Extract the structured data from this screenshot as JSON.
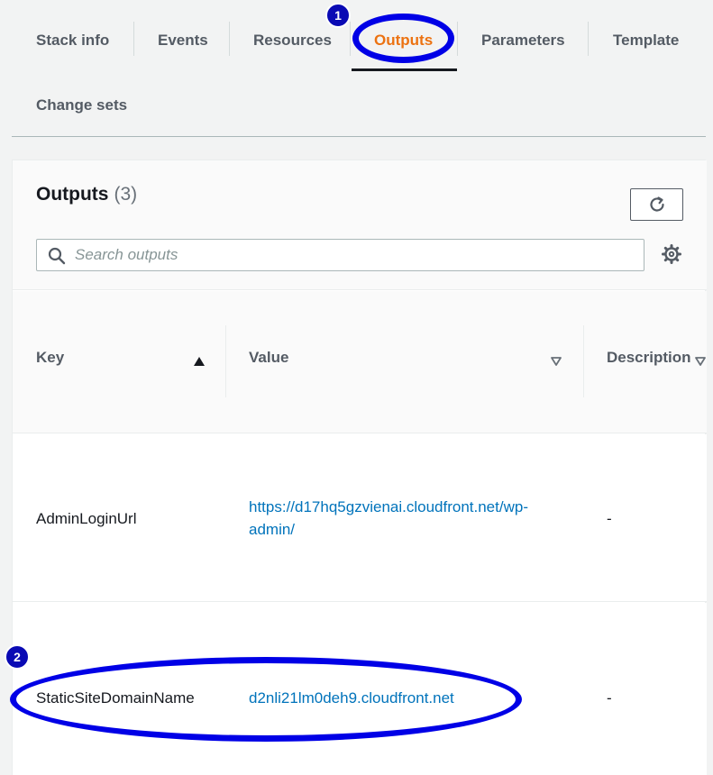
{
  "tabs": [
    {
      "label": "Stack info",
      "active": false
    },
    {
      "label": "Events",
      "active": false
    },
    {
      "label": "Resources",
      "active": false
    },
    {
      "label": "Outputs",
      "active": true
    },
    {
      "label": "Parameters",
      "active": false
    },
    {
      "label": "Template",
      "active": false
    },
    {
      "label": "Change sets",
      "active": false
    }
  ],
  "panel": {
    "title": "Outputs",
    "count": "(3)"
  },
  "search": {
    "placeholder": "Search outputs",
    "value": ""
  },
  "table": {
    "columns": [
      {
        "label": "Key",
        "sort": "ascending"
      },
      {
        "label": "Value",
        "sort": "none"
      },
      {
        "label": "Description",
        "sort": "none"
      }
    ],
    "rows": [
      {
        "key": "AdminLoginUrl",
        "value": "https://d17hq5gzvienai.cloudfront.net/wp-admin/",
        "description": "-"
      },
      {
        "key": "StaticSiteDomainName",
        "value": "d2nli21lm0deh9.cloudfront.net",
        "description": "-"
      }
    ]
  },
  "annotations": [
    {
      "number": "1",
      "target": "Outputs tab"
    },
    {
      "number": "2",
      "target": "StaticSiteDomainName row"
    }
  ],
  "icons": {
    "refresh": "refresh-icon",
    "search": "search-icon",
    "settings": "gear-icon",
    "sort_asc": "caret-up-icon",
    "sort_desc": "caret-down-outline-icon"
  },
  "colors": {
    "active_tab": "#ec7211",
    "link": "#0073bb",
    "annotation": "#0000e6"
  }
}
